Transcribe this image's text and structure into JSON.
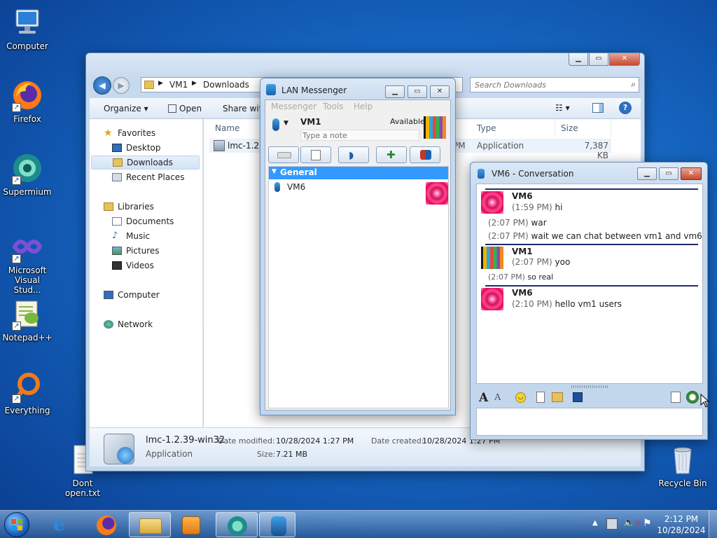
{
  "desktop": {
    "icons": [
      {
        "label": "Computer"
      },
      {
        "label": "Firefox"
      },
      {
        "label": "Supermium"
      },
      {
        "label": "Microsoft Visual Stud..."
      },
      {
        "label": "Notepad++"
      },
      {
        "label": "Everything"
      },
      {
        "label": "Dont open.txt"
      },
      {
        "label": "Recycle Bin"
      }
    ]
  },
  "explorer": {
    "breadcrumb": [
      "VM1",
      "Downloads"
    ],
    "search_placeholder": "Search Downloads",
    "toolbar": {
      "organize": "Organize",
      "open": "Open",
      "share": "Share with"
    },
    "nav": {
      "favorites": "Favorites",
      "desktop": "Desktop",
      "downloads": "Downloads",
      "recent": "Recent Places",
      "libraries": "Libraries",
      "documents": "Documents",
      "music": "Music",
      "pictures": "Pictures",
      "videos": "Videos",
      "computer": "Computer",
      "network": "Network"
    },
    "columns": {
      "name": "Name",
      "type": "Type",
      "size": "Size"
    },
    "file": {
      "name": "lmc-1.2.",
      "date_fragment": "PM",
      "type": "Application",
      "size": "7,387 KB"
    },
    "details": {
      "filename": "lmc-1.2.39-win32",
      "kind": "Application",
      "modified_label": "Date modified:",
      "modified": "10/28/2024 1:27 PM",
      "created_label": "Date created:",
      "created": "10/28/2024 1:27 PM",
      "size_label": "Size:",
      "size": "7.21 MB"
    }
  },
  "messenger": {
    "title": "LAN Messenger",
    "menu": [
      "Messenger",
      "Tools",
      "Help"
    ],
    "user": {
      "name": "VM1",
      "status": "Available",
      "note_placeholder": "Type a note"
    },
    "group": "General",
    "contacts": [
      {
        "name": "VM6"
      }
    ]
  },
  "conversation": {
    "title": "VM6 - Conversation",
    "messages": [
      {
        "sender": "VM6",
        "lines": [
          {
            "time": "(1:59 PM)",
            "text": "hi"
          },
          {
            "time": "(2:07 PM)",
            "text": "war"
          },
          {
            "time": "(2:07 PM)",
            "text": "wait we can chat between vm1 and vm6"
          }
        ]
      },
      {
        "sender": "VM1",
        "lines": [
          {
            "time": "(2:07 PM)",
            "text": "yoo"
          },
          {
            "time": "(2:07 PM)",
            "text": "so real"
          }
        ]
      },
      {
        "sender": "VM6",
        "lines": [
          {
            "time": "(2:10 PM)",
            "text": "hello vm1 users"
          }
        ]
      }
    ],
    "input_value": ""
  },
  "taskbar": {
    "clock_time": "2:12 PM",
    "clock_date": "10/28/2024"
  },
  "colors": {
    "accent": "#3399ff",
    "separator": "#1f2b6b",
    "close_button": "#c64a30"
  }
}
